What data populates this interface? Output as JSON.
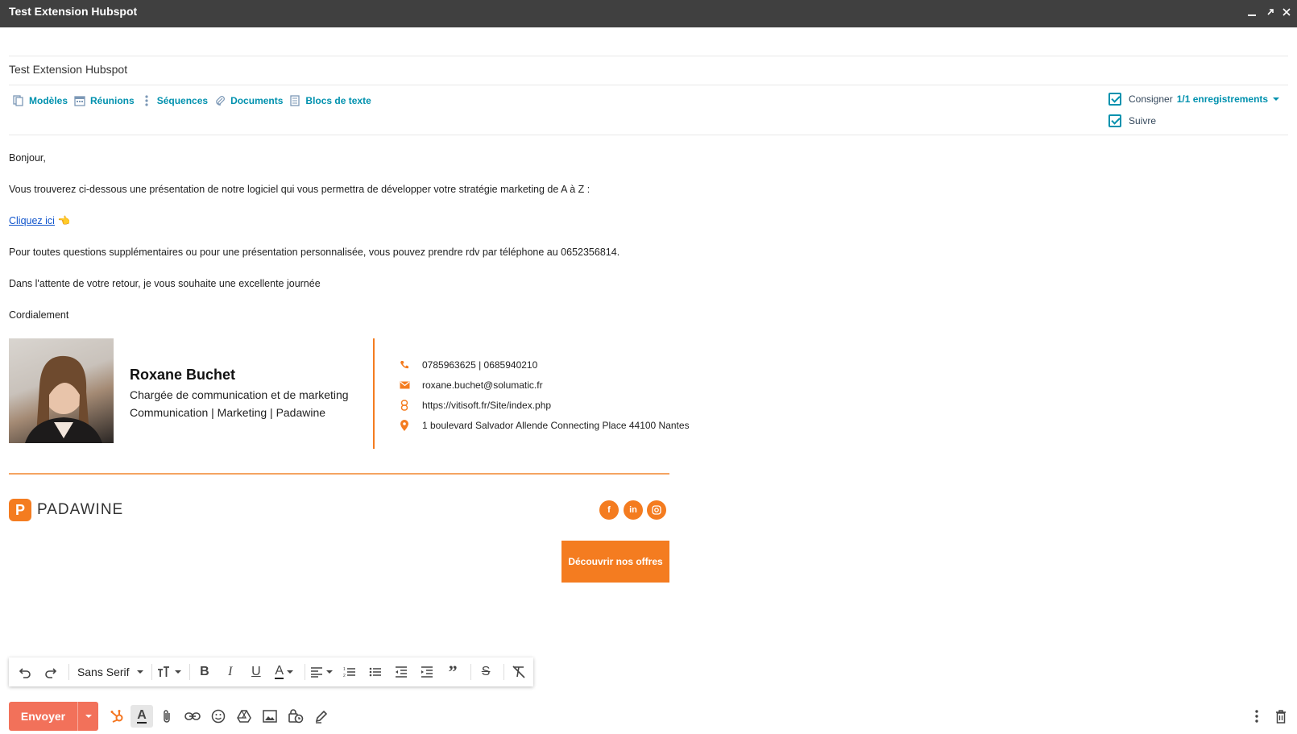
{
  "window": {
    "title": "Test Extension Hubspot"
  },
  "subject": "Test Extension Hubspot",
  "plugin_bar": {
    "items": [
      {
        "label": "Modèles",
        "icon": "templates-icon"
      },
      {
        "label": "Réunions",
        "icon": "calendar-icon"
      },
      {
        "label": "Séquences",
        "icon": "sequences-icon"
      },
      {
        "label": "Documents",
        "icon": "paperclip-icon"
      },
      {
        "label": "Blocs de texte",
        "icon": "snippets-icon"
      }
    ],
    "log_label": "Consigner",
    "log_link": "1/1 enregistrements",
    "track_label": "Suivre",
    "accent": "#0091ae"
  },
  "message": {
    "greeting": "Bonjour,",
    "line1": "Vous trouverez ci-dessous une présentation de notre logiciel qui vous permettra de développer votre stratégie marketing de A à Z :",
    "link_text": "Cliquez ici",
    "link_emoji": "👈",
    "line2": "Pour toutes questions supplémentaires ou pour une présentation personnalisée, vous pouvez prendre rdv par téléphone au 0652356814.",
    "line3": "Dans l'attente de votre retour, je vous souhaite une excellente journée",
    "closing": "Cordialement"
  },
  "signature": {
    "name": "Roxane Buchet",
    "role": "Chargée de communication et de marketing",
    "company_line": "Communication | Marketing | Padawine",
    "phone": "0785963625 | 0685940210",
    "email": "roxane.buchet@solumatic.fr",
    "website": "https://vitisoft.fr/Site/index.php",
    "address": "1 boulevard Salvador Allende Connecting Place 44100 Nantes",
    "logo_text": "PADAWINE",
    "cta_label": "Découvrir nos offres",
    "accent": "#f47c20",
    "social": [
      "facebook-icon",
      "linkedin-icon",
      "instagram-icon"
    ]
  },
  "format_toolbar": {
    "font": "Sans Serif"
  },
  "bottom_bar": {
    "send_label": "Envoyer",
    "send_color": "#f2715a"
  }
}
